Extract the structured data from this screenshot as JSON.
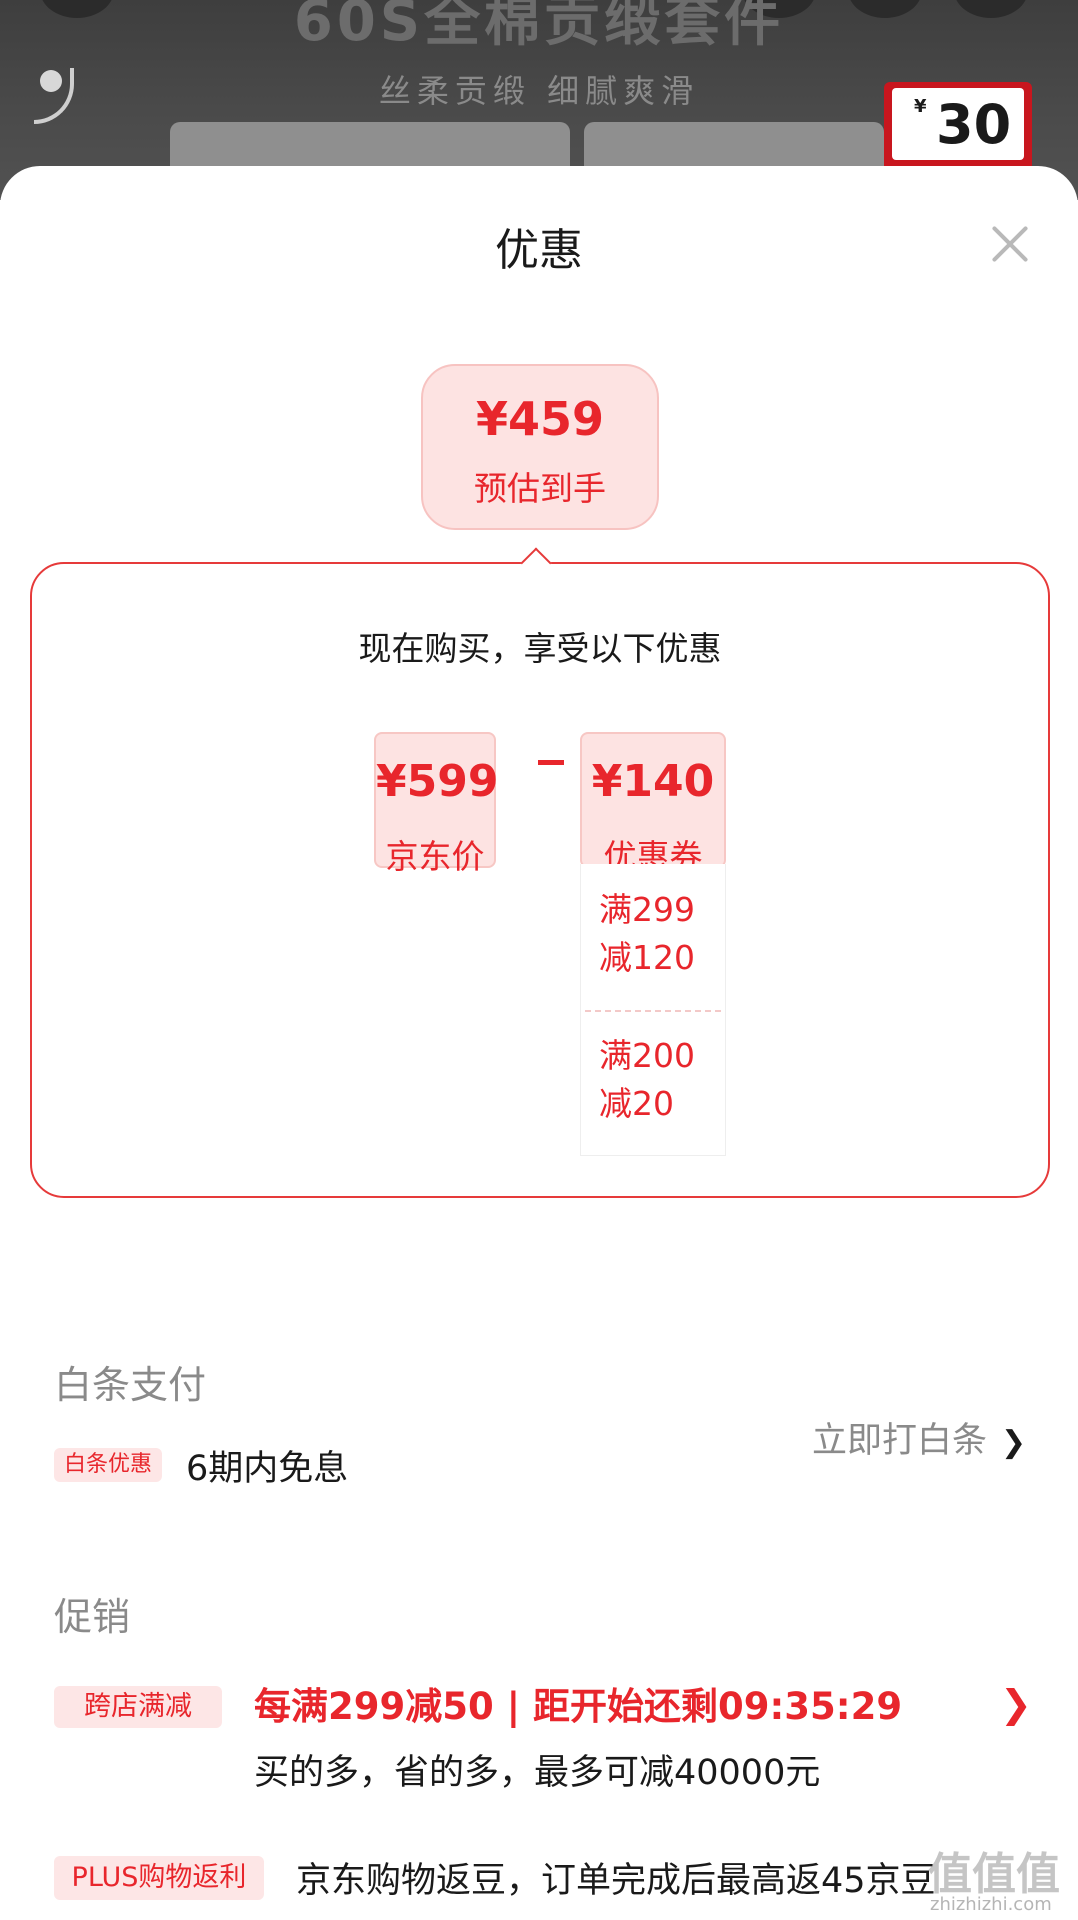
{
  "banner": {
    "title": "60S全棉贡缎套件",
    "subtitle": "丝柔贡缎 细腻爽滑",
    "price_tag_currency": "¥",
    "price_tag_value": "30"
  },
  "sheet": {
    "title": "优惠"
  },
  "estimate": {
    "price": "¥459",
    "label": "预估到手"
  },
  "offer": {
    "heading": "现在购买，享受以下优惠",
    "jd_price": {
      "value": "¥599",
      "label": "京东价"
    },
    "coupon": {
      "value": "¥140",
      "label": "优惠券"
    },
    "coupon_items": [
      {
        "line1": "满299",
        "line2": "减120"
      },
      {
        "line1": "满200",
        "line2": "减20"
      }
    ]
  },
  "baitiao": {
    "section_title": "白条支付",
    "tag": "白条优惠",
    "text": "6期内免息",
    "action": "立即打白条"
  },
  "promotion": {
    "section_title": "促销",
    "tag": "跨店满减",
    "headline": "每满299减50 | 距开始还剩09:35:29",
    "subtext": "买的多，省的多，最多可减40000元",
    "plus_tag": "PLUS购物返利",
    "plus_text": "京东购物返豆，订单完成后最高返45京豆"
  },
  "watermark": {
    "text": "值值值",
    "url": "zhizhizhi.com"
  },
  "colors": {
    "accent": "#e8262c",
    "tag_bg": "#fde6e6",
    "muted_text": "#8a8a8a"
  }
}
